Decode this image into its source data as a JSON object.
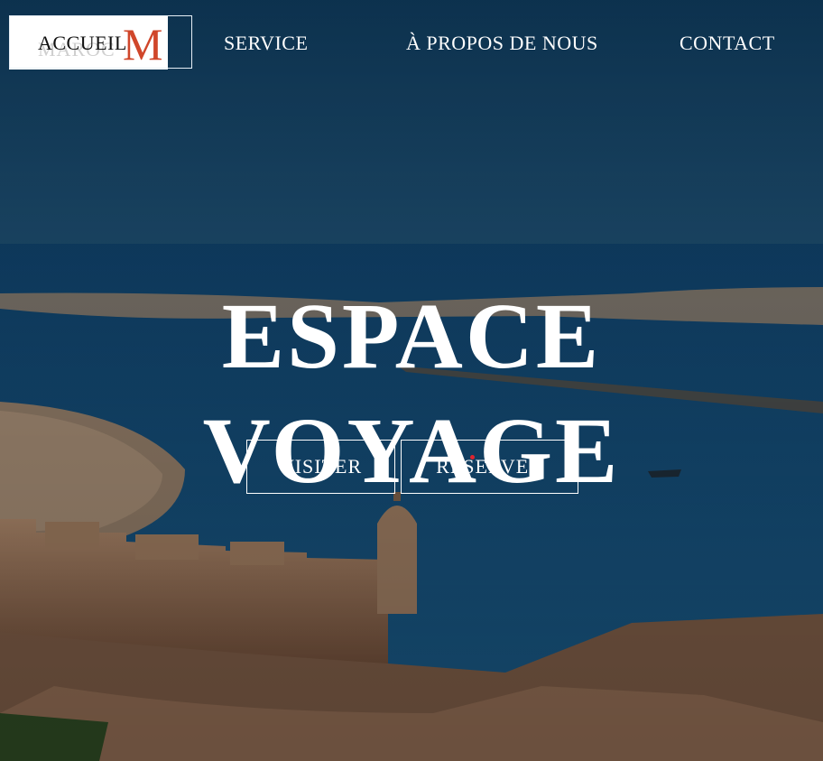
{
  "logo": {
    "word": "MAROC",
    "letter": "M",
    "accent_color": "#d0462a"
  },
  "nav": {
    "accueil": "ACCUEIL",
    "service": "SERVICE",
    "apropos": "À PROPOS DE NOUS",
    "contact": "CONTACT"
  },
  "hero": {
    "title_line1": "ESPACE",
    "title_line2": "VOYAGE",
    "background": "coastal fortress overlooking the ocean"
  },
  "buttons": {
    "visiter": "VISITER",
    "reserver": "RESERVER"
  },
  "colors": {
    "sky": "#173c5c",
    "sea": "#174f79",
    "stone": "#b08a6c",
    "accent": "#d0462a"
  }
}
